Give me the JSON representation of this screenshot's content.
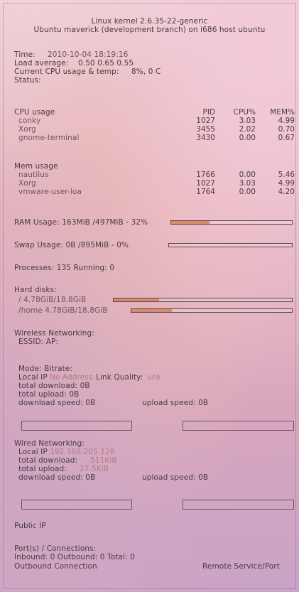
{
  "header": {
    "line1": "Linux kernel 2.6.35-22-generic",
    "line2": "Ubuntu maverick (development branch) on i686 host ubuntu"
  },
  "system": {
    "time_label": "Time:",
    "time_value": "2010-10-04 18:19:16",
    "load_label": "Load average:",
    "load_value": "0.50 0.65 0.55",
    "cpu_label": "Current CPU usage & temp:",
    "cpu_value": "8%, 0  C",
    "status_label": "Status:"
  },
  "cpu_table": {
    "title": "CPU usage",
    "headers": [
      "PID",
      "CPU%",
      "MEM%"
    ],
    "rows": [
      {
        "name": "conky",
        "pid": "1027",
        "cpu": "3.03",
        "mem": "4.99"
      },
      {
        "name": "Xorg",
        "pid": "3455",
        "cpu": "2.02",
        "mem": "0.70"
      },
      {
        "name": "gnome-terminal",
        "pid": "3430",
        "cpu": "0.00",
        "mem": "0.67"
      }
    ]
  },
  "mem_table": {
    "title": "Mem usage",
    "rows": [
      {
        "name": "nautilus",
        "pid": "1766",
        "cpu": "0.00",
        "mem": "5.46"
      },
      {
        "name": "Xorg",
        "pid": "1027",
        "cpu": "3.03",
        "mem": "4.99"
      },
      {
        "name": "vmware-user-loa",
        "pid": "1764",
        "cpu": "0.00",
        "mem": "4.20"
      }
    ]
  },
  "ram": {
    "label": "RAM Usage: 163MiB /497MiB  - 32%",
    "fraction": 0.32
  },
  "swap": {
    "label": "Swap Usage: 0B    /895MiB  - 0%",
    "fraction": 0.0
  },
  "processes": {
    "label": "Processes: 135   Running: 0"
  },
  "disks": {
    "title": "Hard disks:",
    "items": [
      {
        "label": "/ 4.78GiB/18.8GiB",
        "fraction": 0.254
      },
      {
        "label": "/home 4.78GiB/18.8GiB",
        "fraction": 0.254
      }
    ]
  },
  "wireless": {
    "title": "Wireless Networking:",
    "essid": "ESSID:   AP:",
    "mode": "Mode:   Bitrate:",
    "local_ip_label": "Local IP",
    "local_ip_value": "No Address",
    "link_quality_label": "Link Quality:",
    "link_quality_value": "unk",
    "total_download": "total download: 0B",
    "total_upload": "total upload: 0B",
    "download_speed": "download speed: 0B",
    "upload_speed": "upload speed: 0B"
  },
  "wired": {
    "title": "Wired Networking:",
    "local_ip_label": "Local IP",
    "local_ip_value": "192.168.205.128",
    "total_download_label": "total download:",
    "total_download_value": "511KiB",
    "total_upload_label": "total upload:",
    "total_upload_value": "27.5KiB",
    "download_speed": "download speed: 0B",
    "upload_speed": "upload speed: 0B"
  },
  "public_ip": "Public IP",
  "ports": {
    "title": "Port(s) / Connections:",
    "line": "Inbound: 0  Outbound: 0  Total: 0",
    "outbound": "Outbound Connection",
    "remote": "Remote Service/Port"
  },
  "colors": {
    "bar_fill": "#d8896a",
    "bar_border": "#5a4650",
    "ip_accent": "#b27b7f"
  }
}
